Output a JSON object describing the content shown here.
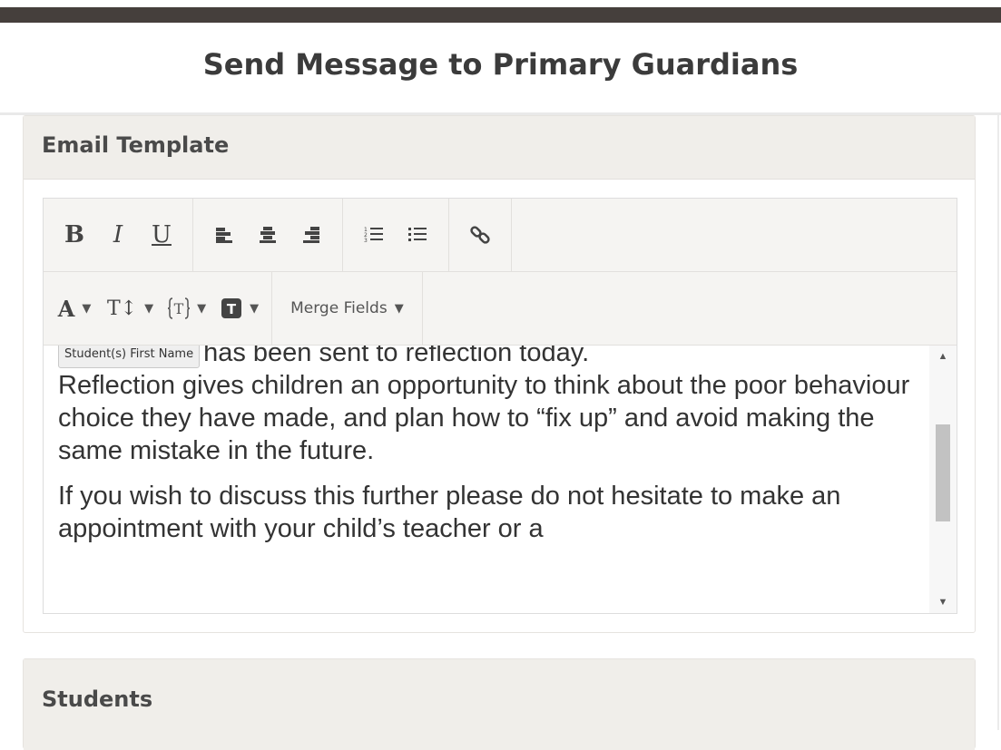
{
  "modal": {
    "title": "Send Message to Primary Guardians"
  },
  "email_panel": {
    "heading": "Email Template"
  },
  "toolbar": {
    "bold": "B",
    "italic": "I",
    "underline": "U",
    "font_color": "A",
    "font_size": "T↕",
    "merge_fields": "Merge Fields",
    "dropdown_caret": "▼"
  },
  "editor": {
    "merge_tag": "Student(s) First Name",
    "line1_after_tag": "has been sent to reflection today.",
    "paragraph1_rest": "Reflection gives children an opportunity to think about the poor behaviour choice they have made, and plan how to “fix up” and avoid making the same mistake in the future.",
    "paragraph2": "If you wish to discuss this further please do not hesitate to make an appointment with your child’s teacher or a",
    "scroll_position": 0.45,
    "visible_fraction": 0.25
  },
  "students_panel": {
    "heading": "Students"
  },
  "colors": {
    "topbar": "#453f3c",
    "panel_heading_bg": "#f0eeea",
    "toolbar_bg": "#f5f4f2",
    "scrollbar_thumb": "#c2c2c2"
  }
}
